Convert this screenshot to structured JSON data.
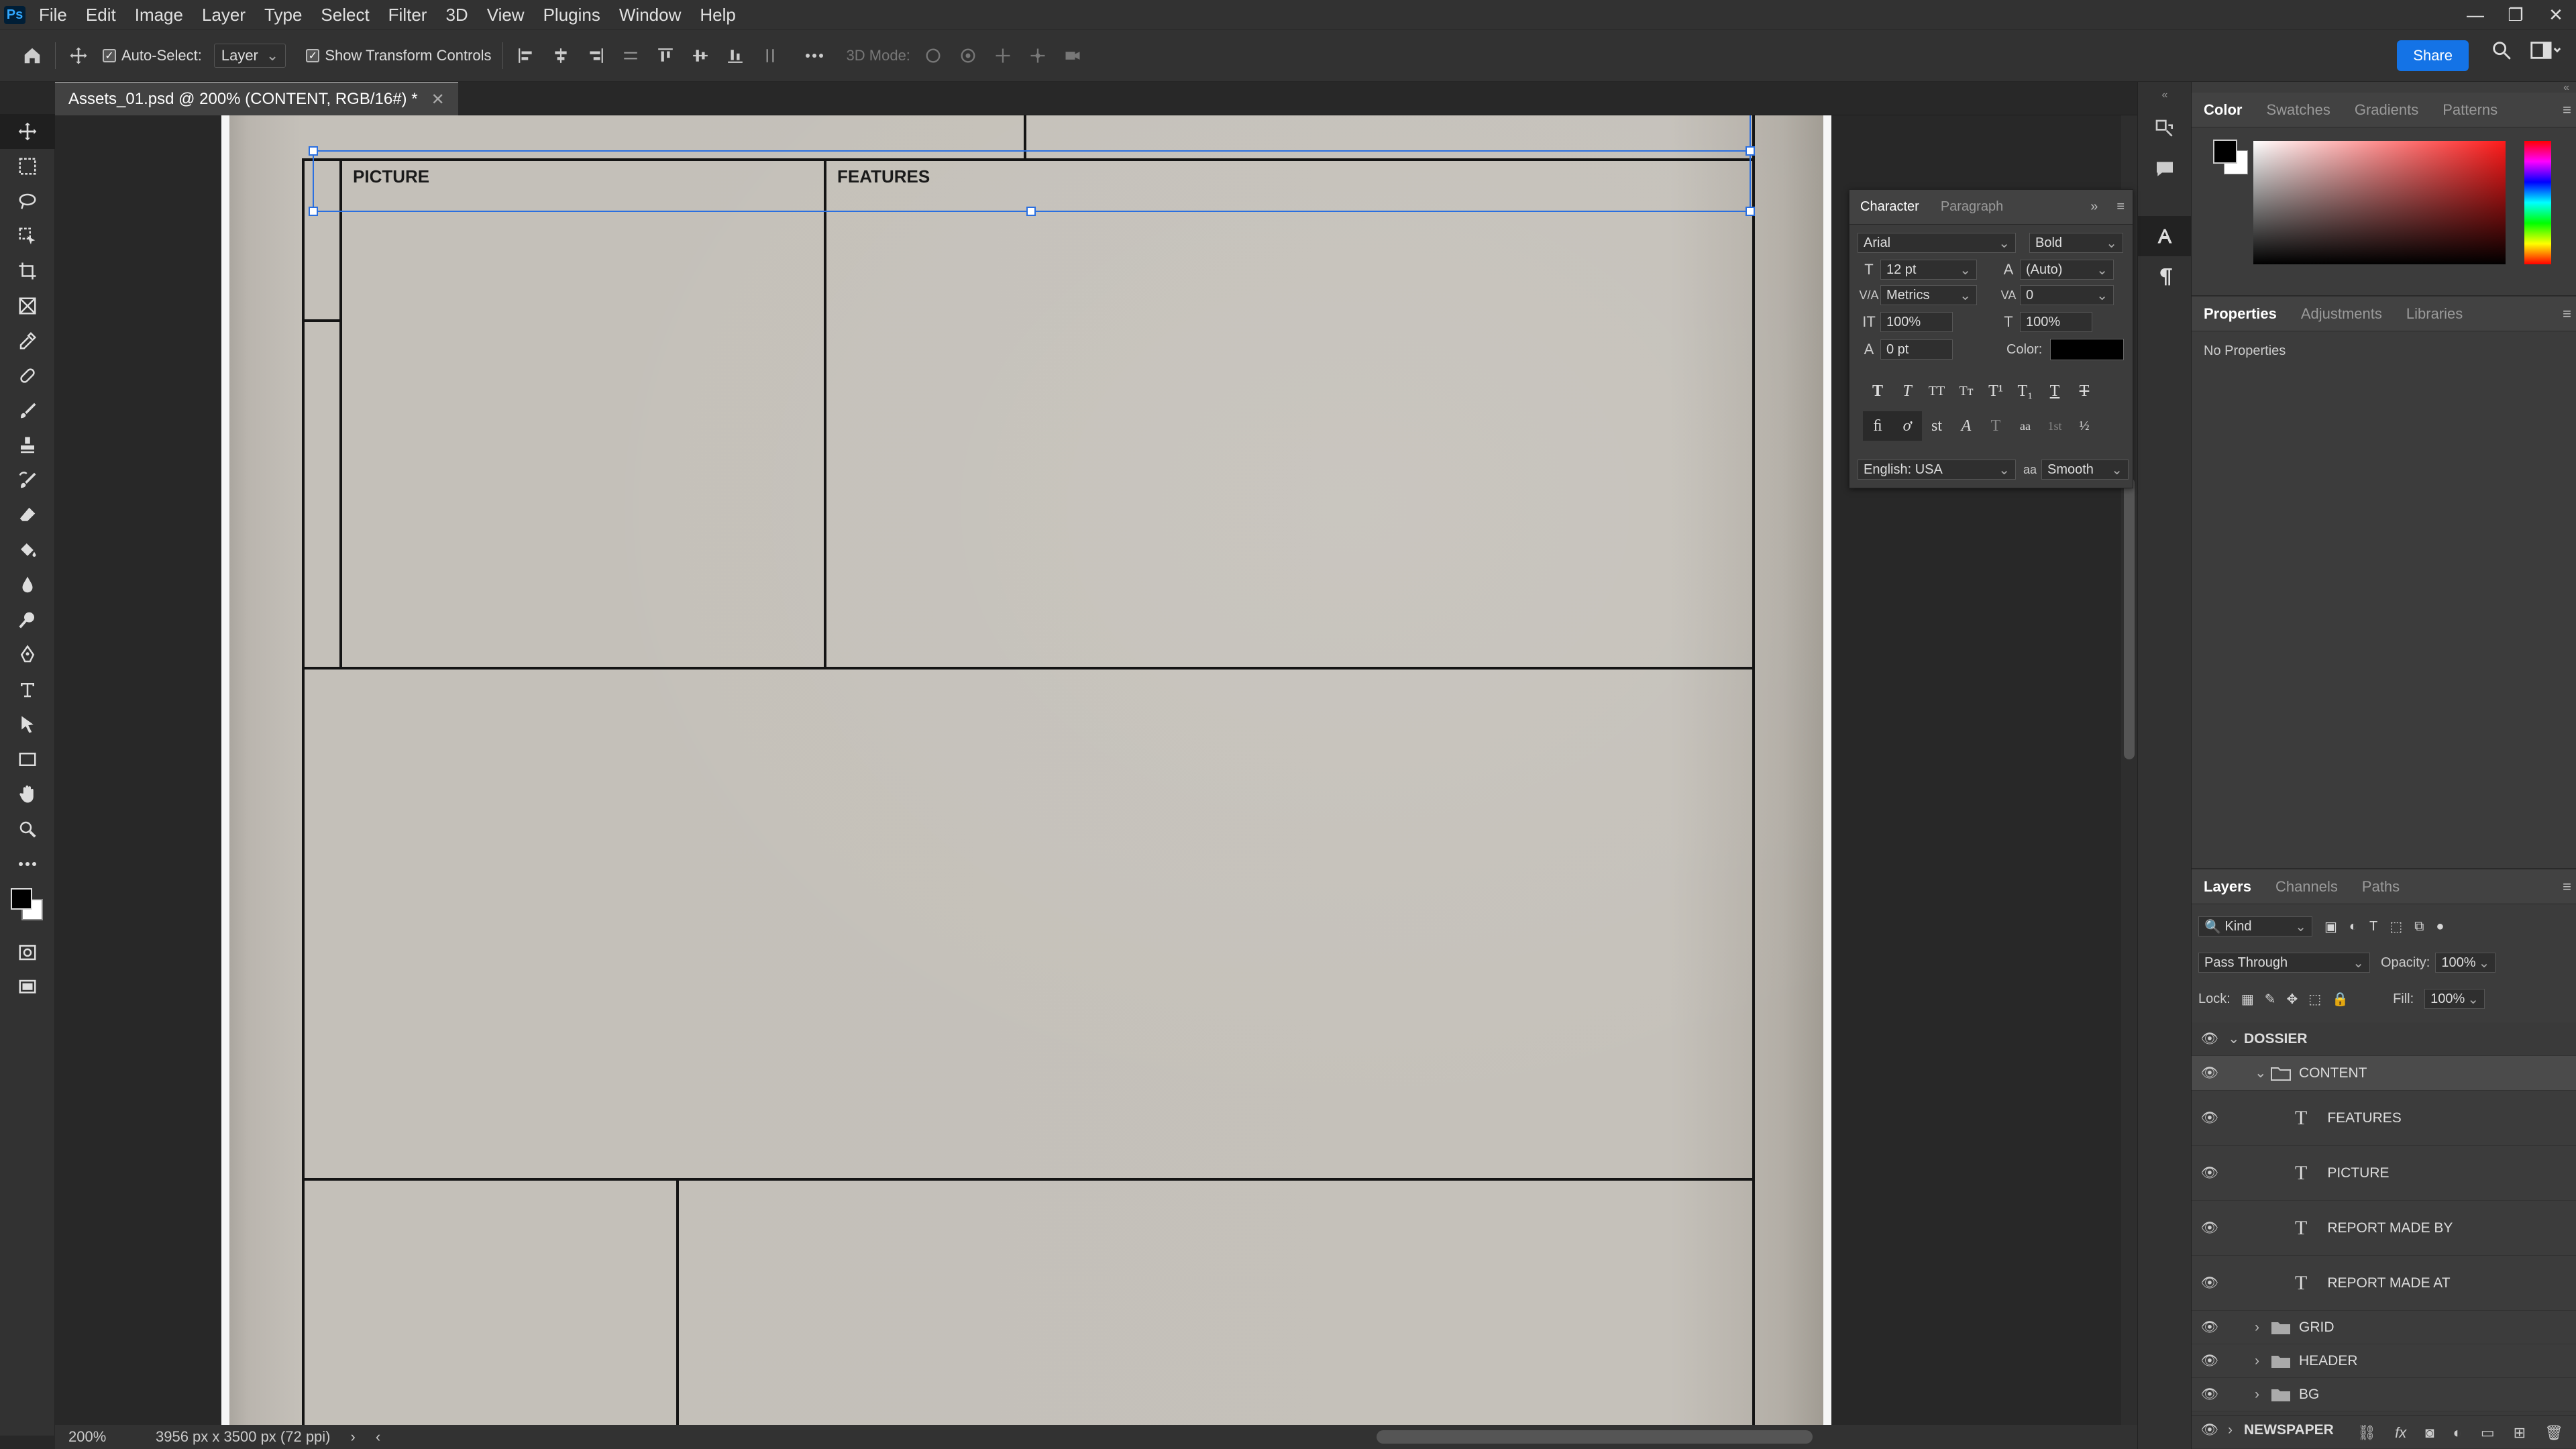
{
  "app": {
    "logo": "Ps"
  },
  "menu": [
    "File",
    "Edit",
    "Image",
    "Layer",
    "Type",
    "Select",
    "Filter",
    "3D",
    "View",
    "Plugins",
    "Window",
    "Help"
  ],
  "options": {
    "auto_select_label": "Auto-Select:",
    "auto_select_value": "Layer",
    "show_transform_label": "Show Transform Controls",
    "mode_3d_label": "3D Mode:",
    "share_label": "Share"
  },
  "document": {
    "tab_title": "Assets_01.psd @ 200% (CONTENT, RGB/16#) *",
    "zoom": "200%",
    "size_info": "3956 px x 3500 px (72 ppi)",
    "labels": {
      "picture": "PICTURE",
      "features": "FEATURES"
    }
  },
  "character": {
    "tabs": [
      "Character",
      "Paragraph"
    ],
    "font_family": "Arial",
    "font_style": "Bold",
    "size": "12 pt",
    "leading": "(Auto)",
    "kerning": "Metrics",
    "tracking": "0",
    "vscale": "100%",
    "hscale": "100%",
    "baseline": "0 pt",
    "color_label": "Color:",
    "color_value": "#000000",
    "language": "English: USA",
    "aa_label": "aa",
    "antialias": "Smooth"
  },
  "color_panel": {
    "tabs": [
      "Color",
      "Swatches",
      "Gradients",
      "Patterns"
    ]
  },
  "properties_panel": {
    "tabs": [
      "Properties",
      "Adjustments",
      "Libraries"
    ],
    "empty": "No Properties"
  },
  "layers_panel": {
    "tabs": [
      "Layers",
      "Channels",
      "Paths"
    ],
    "filter_kind": "Kind",
    "blend_mode": "Pass Through",
    "opacity_label": "Opacity:",
    "opacity": "100%",
    "lock_label": "Lock:",
    "fill_label": "Fill:",
    "fill": "100%",
    "layers": [
      {
        "name": "DOSSIER",
        "type": "group",
        "level": 0,
        "expanded": true,
        "bold": true
      },
      {
        "name": "CONTENT",
        "type": "group",
        "level": 1,
        "expanded": true,
        "selected": true
      },
      {
        "name": "FEATURES",
        "type": "text",
        "level": 2
      },
      {
        "name": "PICTURE",
        "type": "text",
        "level": 2
      },
      {
        "name": "REPORT MADE BY",
        "type": "text",
        "level": 2
      },
      {
        "name": "REPORT MADE AT",
        "type": "text",
        "level": 2
      },
      {
        "name": "GRID",
        "type": "group",
        "level": 1
      },
      {
        "name": "HEADER",
        "type": "group",
        "level": 1
      },
      {
        "name": "BG",
        "type": "group",
        "level": 1
      },
      {
        "name": "NEWSPAPER",
        "type": "group",
        "level": 0,
        "bold": true
      }
    ]
  },
  "colors": {
    "accent": "#1473e6",
    "selection": "#2a6fe0",
    "fg": "#000000",
    "bg": "#ffffff"
  }
}
